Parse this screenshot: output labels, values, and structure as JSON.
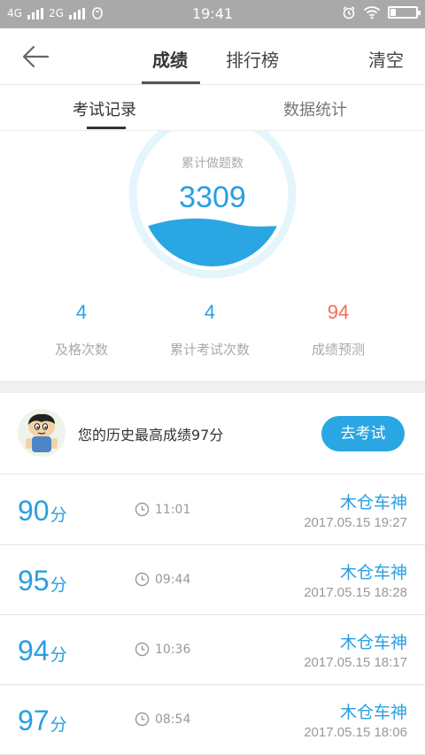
{
  "status_bar": {
    "network_1": "4G",
    "network_2": "2G",
    "time": "19:41"
  },
  "nav": {
    "tab_score": "成绩",
    "tab_ranking": "排行榜",
    "clear_label": "清空"
  },
  "subtabs": {
    "exam_records": "考试记录",
    "data_stats": "数据统计"
  },
  "gauge": {
    "label": "累计做题数",
    "value": "3309"
  },
  "stats": [
    {
      "value": "4",
      "label": "及格次数",
      "color": "#2a9fe0"
    },
    {
      "value": "4",
      "label": "累计考试次数",
      "color": "#2a9fe0"
    },
    {
      "value": "94",
      "label": "成绩预测",
      "color": "#f06d58"
    }
  ],
  "best": {
    "text": "您的历史最高成绩97分",
    "button_label": "去考试"
  },
  "records": [
    {
      "score": "90",
      "unit": "分",
      "duration": "11:01",
      "name": "木仓车神",
      "date": "2017.05.15  19:27"
    },
    {
      "score": "95",
      "unit": "分",
      "duration": "09:44",
      "name": "木仓车神",
      "date": "2017.05.15  18:28"
    },
    {
      "score": "94",
      "unit": "分",
      "duration": "10:36",
      "name": "木仓车神",
      "date": "2017.05.15  18:17"
    },
    {
      "score": "97",
      "unit": "分",
      "duration": "08:54",
      "name": "木仓车神",
      "date": "2017.05.15  18:06"
    }
  ],
  "colors": {
    "accent": "#2a9fe0",
    "prediction": "#f06d58",
    "status_bar": "#a9a9a9"
  }
}
